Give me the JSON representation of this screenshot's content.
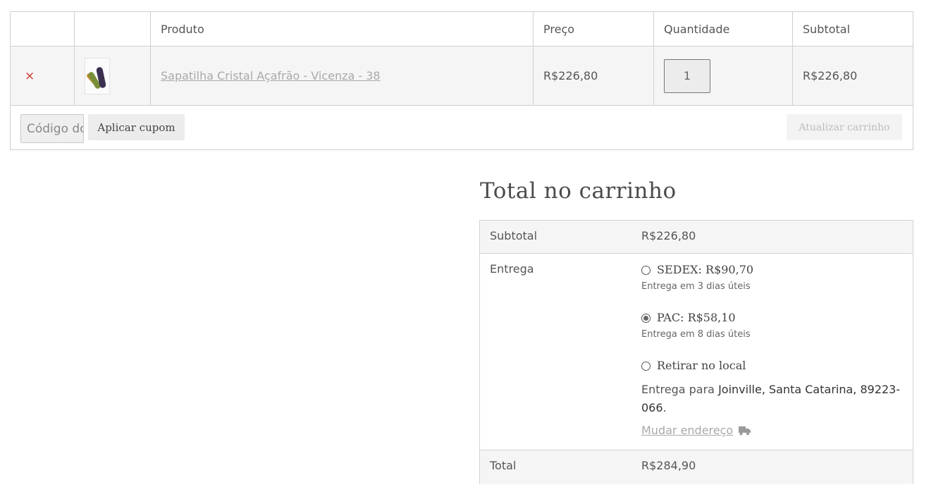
{
  "cart": {
    "headers": {
      "product": "Produto",
      "price": "Preço",
      "quantity": "Quantidade",
      "subtotal": "Subtotal"
    },
    "item": {
      "remove_icon": "×",
      "name": "Sapatilha Cristal Açafrão - Vicenza - 38",
      "price": "R$226,80",
      "quantity": "1",
      "subtotal": "R$226,80"
    },
    "coupon": {
      "placeholder": "Código do cupom"
    },
    "apply_label": "Aplicar cupom",
    "update_label": "Atualizar carrinho"
  },
  "totals": {
    "title": "Total no carrinho",
    "subtotal_label": "Subtotal",
    "subtotal_value": "R$226,80",
    "shipping_label": "Entrega",
    "shipping_options": [
      {
        "label": "SEDEX: R$90,70",
        "desc": "Entrega em 3 dias úteis",
        "selected": false
      },
      {
        "label": "PAC: R$58,10",
        "desc": "Entrega em 8 dias úteis",
        "selected": true
      },
      {
        "label": "Retirar no local",
        "desc": "",
        "selected": false
      }
    ],
    "destination_prefix": "Entrega para",
    "destination": "Joinville, Santa Catarina, 89223-066",
    "destination_suffix": ".",
    "change_address": "Mudar endereço",
    "total_label": "Total",
    "total_value": "R$284,90"
  },
  "icons": {
    "remove": "close-icon",
    "shipping": "truck-icon"
  },
  "colors": {
    "remove": "#d0342c",
    "muted_link": "#a9a9a9"
  }
}
